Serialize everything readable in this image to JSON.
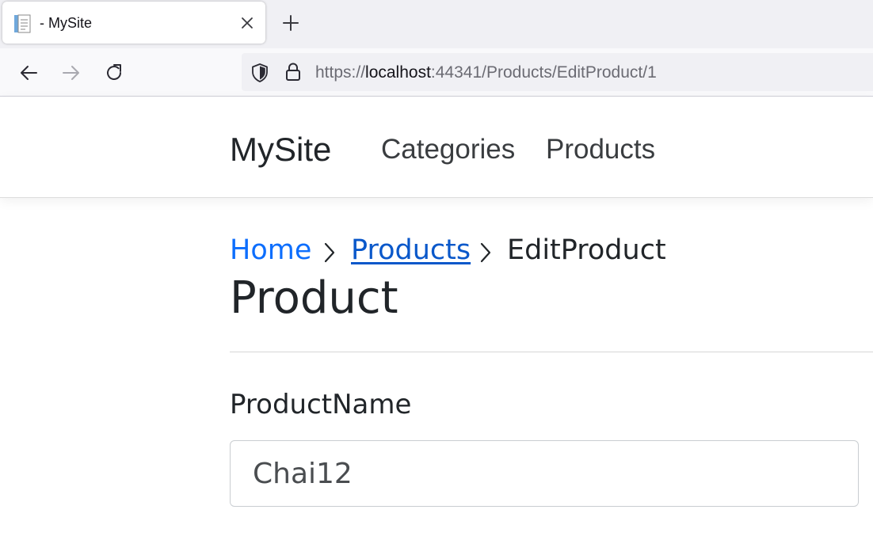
{
  "browser": {
    "tab": {
      "title": "- MySite",
      "favicon": "document-icon",
      "close_icon": "close-icon"
    },
    "new_tab_icon": "plus-icon",
    "nav": {
      "back_icon": "arrow-left-icon",
      "forward_icon": "arrow-right-icon",
      "reload_icon": "reload-icon"
    },
    "url": {
      "scheme": "https://",
      "host": "localhost",
      "rest": ":44341/Products/EditProduct/1"
    }
  },
  "site": {
    "brand": "MySite",
    "nav": [
      {
        "label": "Categories"
      },
      {
        "label": "Products"
      }
    ]
  },
  "breadcrumb": {
    "items": [
      {
        "label": "Home"
      },
      {
        "label": "Products"
      },
      {
        "label": "EditProduct"
      }
    ],
    "separator_icon": "chevron-right-icon"
  },
  "page": {
    "title": "Product",
    "form": {
      "product_name_label": "ProductName",
      "product_name_value": "Chai12"
    }
  },
  "colors": {
    "link": "#0d6efd",
    "link_visited": "#0a58ca",
    "text": "#212529",
    "chrome_bg": "#f0f0f4"
  }
}
